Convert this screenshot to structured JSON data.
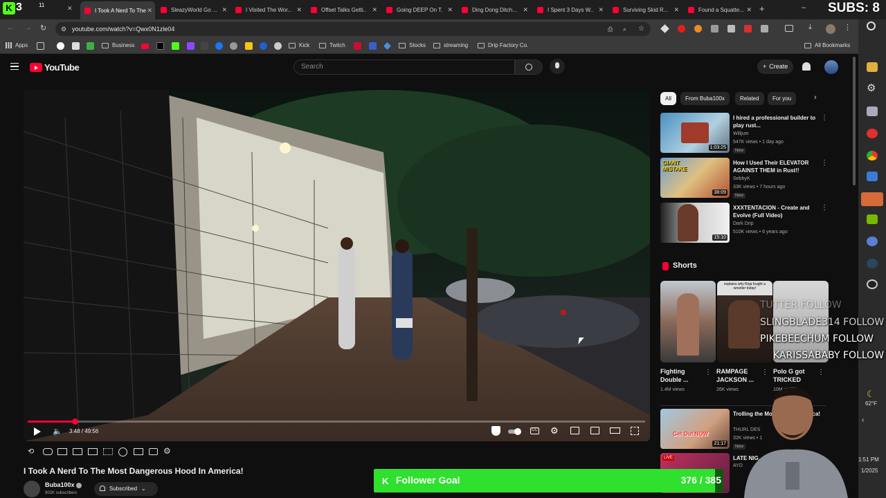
{
  "stream": {
    "kick_badge": "K",
    "viewer_top": "3",
    "viewer_sub": "11",
    "subs_label": "SUBS: 8"
  },
  "tabs": [
    {
      "title": "I Took A Nerd To The Most..."
    },
    {
      "title": "SleazyWorld Go ..."
    },
    {
      "title": "I Visited The Wor..."
    },
    {
      "title": "Offset Talks Getti..."
    },
    {
      "title": "Going DEEP On T..."
    },
    {
      "title": "Ding Dong Ditch..."
    },
    {
      "title": "I Spent 3 Days W..."
    },
    {
      "title": "Surviving Skid R..."
    },
    {
      "title": "Found a Squatte..."
    }
  ],
  "new_tab": "+",
  "address": {
    "url": "youtube.com/watch?v=Qwx0N1zle04"
  },
  "bookmarks": {
    "apps": "Apps",
    "business": "Business",
    "kick": "Kick",
    "twitch": "Twitch",
    "stocks": "Stocks",
    "streaming": "streaming",
    "drip": "Drip Factory Co.",
    "all": "All Bookmarks"
  },
  "youtube": {
    "logo_text": "YouTube",
    "search_placeholder": "Search",
    "create_label": "Create"
  },
  "player": {
    "time": "3:48 / 49:56",
    "progress": 0.076
  },
  "video": {
    "title": "I Took A Nerd To The Most Dangerous Hood In America!",
    "channel": "Buba100x",
    "subscribers": "902K subscribers",
    "subscribed_label": "Subscribed"
  },
  "chips": [
    "All",
    "From Buba100x",
    "Related",
    "For you"
  ],
  "recommendations": [
    {
      "title": "I hired a professional builder to play rust...",
      "channel": "Willjum",
      "meta": "547K views • 1 day ago",
      "duration": "1:03:25",
      "badge": "New"
    },
    {
      "title": "How I Used Their ELEVATOR AGAINST THEM in Rust!!",
      "channel": "SebbyK",
      "meta": "33K views • 7 hours ago",
      "duration": "38:09",
      "badge": "New"
    },
    {
      "title": "XXXTENTACION - Create and Evolve (Full Video)",
      "channel": "Dark Drip",
      "meta": "510K views • 6 years ago",
      "duration": "15:10",
      "badge": ""
    }
  ],
  "shorts": {
    "heading": "Shorts",
    "items": [
      {
        "title": "Fighting Double ...",
        "views": "1.4M views"
      },
      {
        "title": "RAMPAGE JACKSON ...",
        "views": "26K views"
      },
      {
        "title": "Polo G got TRICKED",
        "views": "10M views"
      }
    ],
    "overlay_caption": "explains why Roja fought a wrestler today!"
  },
  "rec2": [
    {
      "title": "Trolling the Most Fr... in America!",
      "channel": "THURL DES",
      "meta": "32K views • 1",
      "duration": "21:17",
      "badge": "New",
      "thumb_text": "Get Out NOW"
    },
    {
      "title": "LATE NIG...",
      "channel": "AYD",
      "meta": "",
      "duration": "",
      "badge": "",
      "thumb_text": "LIVE"
    }
  ],
  "overlay": {
    "followers": [
      "TUTTER FOLLOW",
      "SLINGBLADE314 FOLLOW",
      "PIKEBEECHUM FOLLOW",
      "KARISSABABY FOLLOW"
    ],
    "goal_label": "Follower Goal",
    "goal_count": "376 / 385",
    "goal_progress": 0.977
  },
  "system": {
    "temp": "62°F",
    "time": "1:51 PM",
    "date": "1/2025"
  },
  "colors": {
    "youtube_red": "#ff0033",
    "kick_green": "#53fc18",
    "goal_green": "#2fe02f"
  }
}
